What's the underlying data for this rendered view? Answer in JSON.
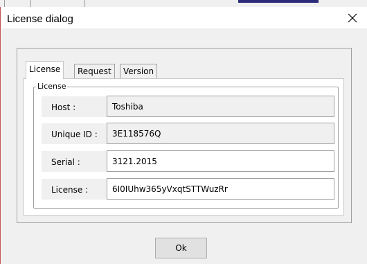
{
  "window": {
    "title": "License dialog",
    "close_icon": "close-icon"
  },
  "tabs": [
    {
      "label": "License",
      "active": true
    },
    {
      "label": "Request",
      "active": false
    },
    {
      "label": "Version",
      "active": false
    }
  ],
  "license_group": {
    "legend": "License",
    "fields": [
      {
        "label": "Host :",
        "value": "Toshiba",
        "editable": false
      },
      {
        "label": "Unique ID :",
        "value": "3E118576Q",
        "editable": false
      },
      {
        "label": "Serial :",
        "value": "3121.2015",
        "editable": true
      },
      {
        "label": "License :",
        "value": "6I0IUhw365yVxqtSTTWuzRr",
        "editable": true
      }
    ]
  },
  "buttons": {
    "ok_label": "Ok"
  },
  "colors": {
    "dialog_face": "#f0f0f0",
    "panel_bg": "#ffffff",
    "border": "#a0a0a0",
    "window_edge": "#c0504d"
  }
}
